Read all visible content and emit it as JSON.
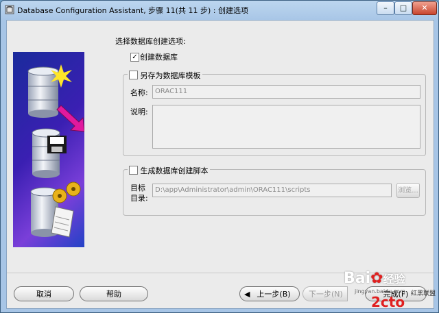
{
  "window": {
    "title": "Database Configuration Assistant, 步骤 11(共 11 步) : 创建选项",
    "controls": {
      "minimize": "–",
      "maximize": "□",
      "close": "✕"
    }
  },
  "main": {
    "heading": "选择数据库创建选项:",
    "create_db": {
      "label": "创建数据库",
      "checked": true
    },
    "save_template": {
      "label": "另存为数据库模板",
      "checked": false,
      "name_label": "名称:",
      "name_value": "ORAC111",
      "desc_label": "说明:",
      "desc_value": ""
    },
    "gen_scripts": {
      "label": "生成数据库创建脚本",
      "checked": false,
      "dir_label_1": "目标",
      "dir_label_2": "目录:",
      "dir_value": "D:\\app\\Administrator\\admin\\ORAC111\\scripts",
      "browse_label": "浏览..."
    }
  },
  "footer": {
    "cancel": "取消",
    "help": "帮助",
    "back": "上一步(B)",
    "next": "下一步(N)",
    "finish": "完成(F)"
  },
  "watermark": {
    "baidu": "Bai",
    "baidu2": "经验",
    "site": "jingyan.baidu.com",
    "logo": "2cto",
    "logo_sub": "红黑联盟"
  },
  "colors": {
    "sidebar_top": "#1a2b9c",
    "sidebar_mid": "#7a3fd9",
    "arrow": "#e0199e"
  }
}
